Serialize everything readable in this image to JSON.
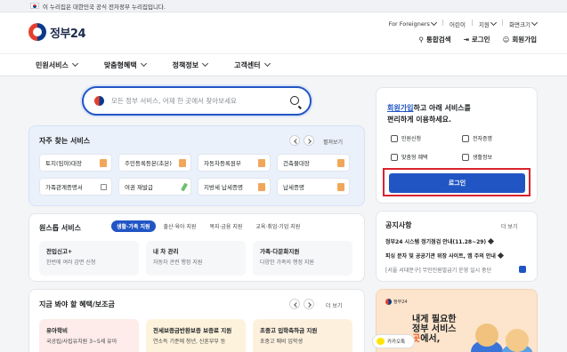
{
  "gov_bar": {
    "text": "이 누리집은 대한민국 공식 전자정부 누리집입니다."
  },
  "header": {
    "logo_text": "정부24",
    "util": [
      "For Foreigners",
      "어린이",
      "지원",
      "화면크기"
    ],
    "actions": {
      "search": "통합검색",
      "login": "로그인",
      "join": "회원가입"
    }
  },
  "nav": [
    "민원서비스",
    "맞춤형혜택",
    "정책정보",
    "고객센터"
  ],
  "search": {
    "placeholder": "모든 정부 서비스, 어제 한 곳에서 찾아보세요"
  },
  "frequent": {
    "title": "자주 찾는 서비스",
    "more": "펼쳐보기",
    "tiles": [
      "토지(임야)대장",
      "주민등록등본(초본)",
      "자동차등록원부",
      "건축물대장",
      "가족관계증명서",
      "여권 재발급",
      "지방세 납세증명",
      "납세증명"
    ]
  },
  "onestop": {
    "title": "원스톱 서비스",
    "chips": [
      "생활·가족 지원",
      "출산·육아 지원",
      "복지·금융 지원",
      "교육·취업·기업 지원"
    ],
    "boxes": [
      {
        "title": "전입신고+",
        "desc": "한번에 여러 감면 신청"
      },
      {
        "title": "내 차 관리",
        "desc": "자동차 관련 행정 지원"
      },
      {
        "title": "가족·다문화지원",
        "desc": "다양한 가족의 행정 지원"
      }
    ]
  },
  "benefit": {
    "title": "지금 봐야 할 혜택/보조금",
    "more": "더 보기",
    "cards": [
      {
        "title": "유아학비",
        "desc": "국공립/사립유치원 3~5세 유아"
      },
      {
        "title": "전세보증금반환보증 보증료 지원",
        "desc": "연소득 기준에 청년, 신혼부부 등"
      },
      {
        "title": "초중고 입학축하금 지원",
        "desc": "초중고 매비 입학생"
      }
    ]
  },
  "login_card": {
    "line1_link": "회원가입",
    "line1_rest": "하고 아래 서비스를",
    "line2": "편리하게 이용하세요.",
    "quick": [
      "민원신청",
      "전자증명",
      "맞춤형 혜택",
      "생활정보"
    ],
    "button": "로그인"
  },
  "notice": {
    "title": "공지사항",
    "more": "더 보기",
    "items": [
      "정부24 시스템 정기점검 안내(11.28~29)",
      "피싱 문자 및 공공기관 위장 사이트, 앱 주의 안내",
      "[서울 서대문구] 무인민원발급기 운영 일시 중단"
    ]
  },
  "promo": {
    "brand": "정부24",
    "line1": "내게 필요한",
    "line2": "정부 서비스",
    "line3a": "곳",
    "line3b": "에서,"
  },
  "kakao": {
    "label": "카카오톡"
  }
}
